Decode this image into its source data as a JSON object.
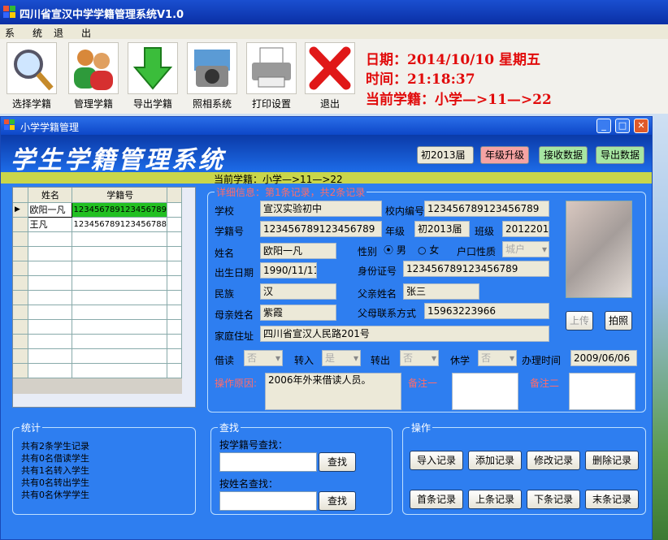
{
  "app": {
    "title": "四川省宣汉中学学籍管理系统V1.0"
  },
  "menu": [
    "系",
    "统",
    "退",
    "出"
  ],
  "toolbar": [
    {
      "label": "选择学籍",
      "icon": "magnifier-icon"
    },
    {
      "label": "管理学籍",
      "icon": "users-icon"
    },
    {
      "label": "导出学籍",
      "icon": "arrow-down-icon"
    },
    {
      "label": "照相系统",
      "icon": "camera-icon"
    },
    {
      "label": "打印设置",
      "icon": "printer-icon"
    },
    {
      "label": "退出",
      "icon": "red-x-icon"
    }
  ],
  "info": {
    "date": "日期：2014/10/10   星期五",
    "time": "时间：21:18:37",
    "current": "当前学籍：小学—>11—>22"
  },
  "child": {
    "title": "小学学籍管理",
    "banner": "学生学籍管理系统",
    "grade_select": "初2013届",
    "btn_upgrade": "年级升级",
    "btn_receive": "接收数据",
    "btn_export": "导出数据",
    "current": "当前学籍：小学—>11—>22",
    "grid": {
      "headers": [
        "姓名",
        "学籍号"
      ],
      "rows": [
        [
          "欧阳一凡",
          "123456789123456789"
        ],
        [
          "王凡",
          "123456789123456788"
        ]
      ]
    },
    "detail": {
      "legend": "详细信息：第1条记录，共2条记录",
      "school_label": "学校",
      "school": "宣汉实验初中",
      "schoolno_label": "校内编号",
      "schoolno": "123456789123456789",
      "stuno_label": "学籍号",
      "stuno": "123456789123456789",
      "grade_label": "年级",
      "grade": "初2013届",
      "class_label": "班级",
      "class": "2012201",
      "name_label": "姓名",
      "name": "欧阳一凡",
      "gender_label": "性别",
      "male": "男",
      "female": "女",
      "hukou_label": "户口性质",
      "hukou": "城户",
      "birth_label": "出生日期",
      "birth": "1990/11/11",
      "id_label": "身份证号",
      "id": "123456789123456789",
      "nation_label": "民族",
      "nation": "汉",
      "father_label": "父亲姓名",
      "father": "张三",
      "mother_label": "母亲姓名",
      "mother": "紫霞",
      "phone_label": "父母联系方式",
      "phone": "15963223966",
      "addr_label": "家庭住址",
      "addr": "四川省宣汉人民路201号",
      "upload": "上传",
      "photo": "拍照",
      "jiedu_label": "借读",
      "jiedu": "否",
      "zhuanru_label": "转入",
      "zhuanru": "是",
      "zhuanchu_label": "转出",
      "zhuanchu": "否",
      "xiuxue_label": "休学",
      "xiuxue": "否",
      "date_label": "办理时间",
      "date": "2009/06/06",
      "reason_label": "操作原因:",
      "reason": "2006年外来借读人员。",
      "note1_label": "备注一",
      "note2_label": "备注二"
    },
    "stats": {
      "legend": "统计",
      "lines": [
        "共有2条学生记录",
        "共有0名借读学生",
        "共有1名转入学生",
        "共有0名转出学生",
        "共有0名休学学生"
      ]
    },
    "search": {
      "legend": "查找",
      "by_no": "按学籍号查找：",
      "by_name": "按姓名查找：",
      "btn": "查找"
    },
    "ops": {
      "legend": "操作",
      "buttons": [
        "导入记录",
        "添加记录",
        "修改记录",
        "删除记录",
        "首条记录",
        "上条记录",
        "下条记录",
        "末条记录"
      ]
    }
  }
}
